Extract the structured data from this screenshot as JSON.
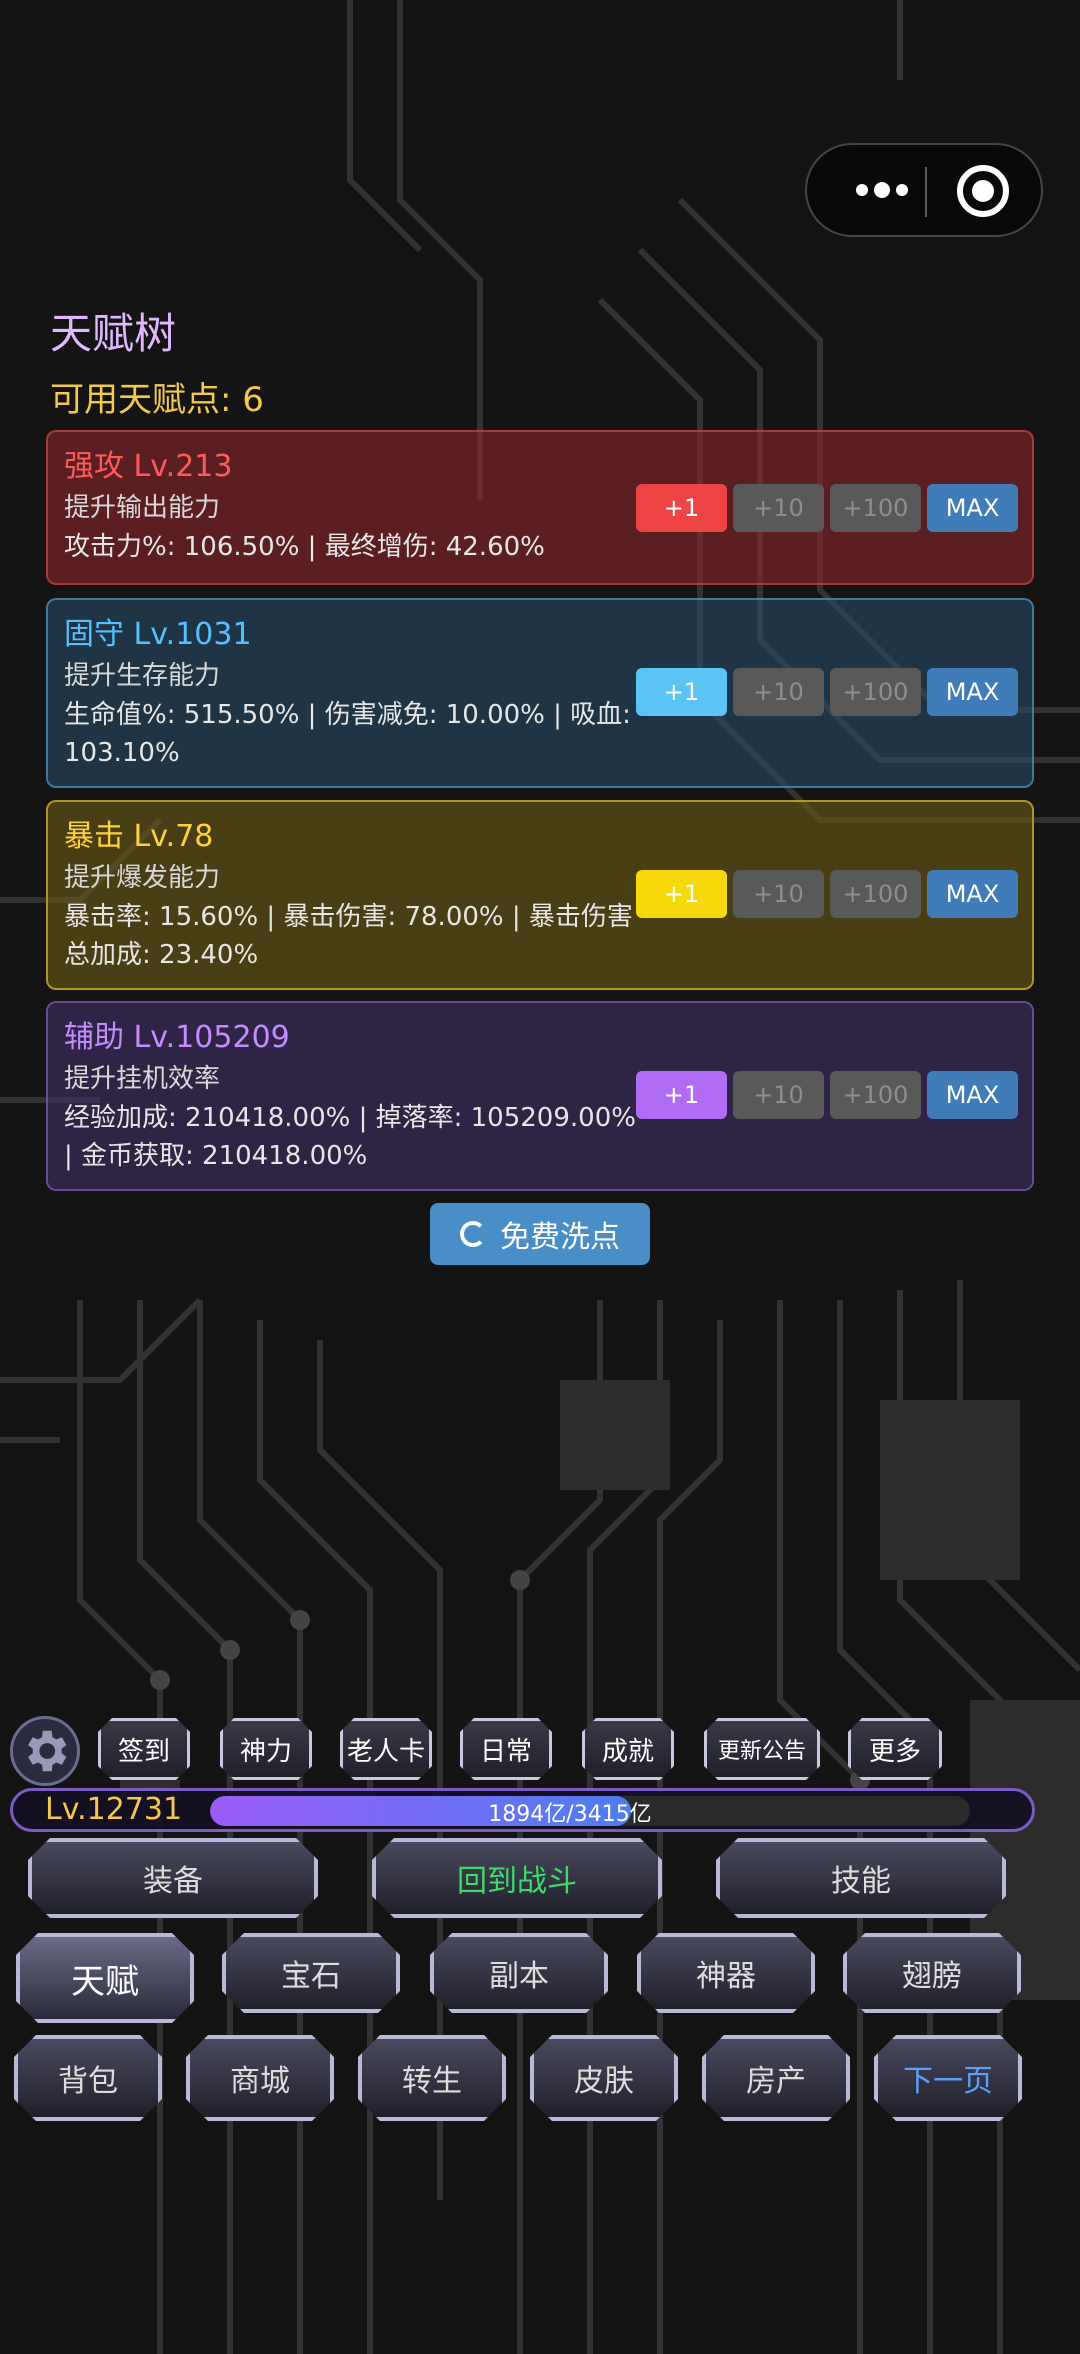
{
  "header": {
    "title": "天赋树",
    "points_label": "可用天赋点: ",
    "points_value": "6"
  },
  "talents": [
    {
      "name": "强攻",
      "level": "Lv.213",
      "desc": "提升输出能力",
      "stats": "攻击力%: 106.50% | 最终增伤: 42.60%",
      "color": "#ff5a5a"
    },
    {
      "name": "固守",
      "level": "Lv.1031",
      "desc": "提升生存能力",
      "stats": "生命值%: 515.50% | 伤害减免: 10.00% | 吸血: 103.10%",
      "color": "#56c0ff"
    },
    {
      "name": "暴击",
      "level": "Lv.78",
      "desc": "提升爆发能力",
      "stats": "暴击率: 15.60% | 暴击伤害: 78.00% | 暴击伤害总加成: 23.40%",
      "color": "#ffd23a"
    },
    {
      "name": "辅助",
      "level": "Lv.105209",
      "desc": "提升挂机效率",
      "stats": "经验加成: 210418.00% | 掉落率: 105209.00% | 金币获取: 210418.00%",
      "color": "#c58bff"
    }
  ],
  "upgrade_buttons": {
    "plus1": "+1",
    "plus10": "+10",
    "plus100": "+100",
    "max": "MAX"
  },
  "reset": {
    "label": "免费洗点",
    "icon": "refresh-icon"
  },
  "top_menu": {
    "settings_icon": "gear-icon",
    "items": [
      "签到",
      "神力",
      "老人卡",
      "日常",
      "成就",
      "更新公告",
      "更多"
    ]
  },
  "level_bar": {
    "level": "Lv.12731",
    "current": "1894亿",
    "total": "3415亿",
    "ratio": "1894亿/3415亿",
    "progress": 0.5546
  },
  "main_nav": {
    "row1": [
      "装备",
      "回到战斗",
      "技能"
    ],
    "row2": [
      "天赋",
      "宝石",
      "副本",
      "神器",
      "翅膀"
    ],
    "row3": [
      "背包",
      "商城",
      "转生",
      "皮肤",
      "房产",
      "下一页"
    ]
  },
  "capsule": {
    "more_icon": "more-dots-icon",
    "close_icon": "target-icon"
  }
}
